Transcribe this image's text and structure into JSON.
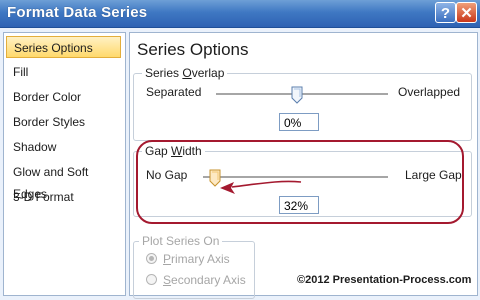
{
  "window": {
    "title": "Format Data Series",
    "help_button": "?",
    "close_button": "✕"
  },
  "nav": {
    "items": [
      {
        "label": "Series Options",
        "selected": true
      },
      {
        "label": "Fill",
        "selected": false
      },
      {
        "label": "Border Color",
        "selected": false
      },
      {
        "label": "Border Styles",
        "selected": false
      },
      {
        "label": "Shadow",
        "selected": false
      },
      {
        "label": "Glow and Soft Edges",
        "selected": false
      },
      {
        "label": "3-D Format",
        "selected": false
      }
    ]
  },
  "panel": {
    "title": "Series Options",
    "series_overlap": {
      "group_label_pre": "Series ",
      "group_label_key": "O",
      "group_label_post": "verlap",
      "left_label": "Separated",
      "right_label": "Overlapped",
      "value": "0%",
      "level_fraction": 0.5
    },
    "gap_width": {
      "group_label_pre": "Gap ",
      "group_label_key": "W",
      "group_label_post": "idth",
      "left_label": "No Gap",
      "right_label": "Large Gap",
      "value": "32%",
      "level_fraction": 0.064
    },
    "plot_series_on": {
      "group_label": "Plot Series On",
      "primary": {
        "pre": "",
        "key": "P",
        "post": "rimary Axis",
        "selected": true
      },
      "secondary": {
        "pre": "",
        "key": "S",
        "post": "econdary Axis",
        "selected": false
      }
    }
  },
  "watermark": "©2012 Presentation-Process.com",
  "colors": {
    "title_bar": "#3f78c3",
    "nav_selected": "#ffd96c",
    "highlight": "#a4192f"
  }
}
